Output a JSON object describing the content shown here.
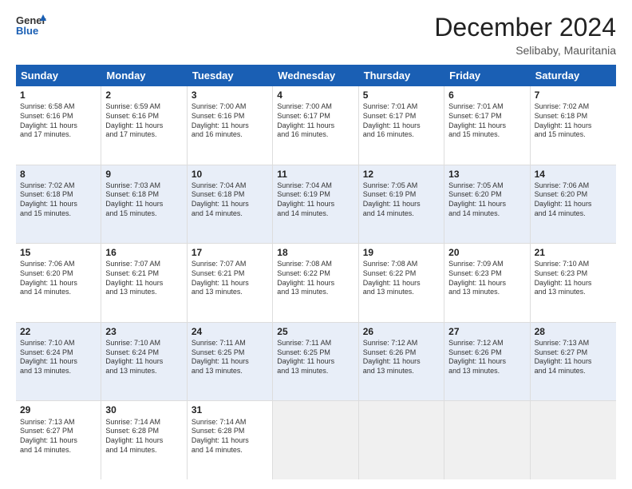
{
  "header": {
    "logo_line1": "General",
    "logo_line2": "Blue",
    "month_title": "December 2024",
    "location": "Selibaby, Mauritania"
  },
  "days_of_week": [
    "Sunday",
    "Monday",
    "Tuesday",
    "Wednesday",
    "Thursday",
    "Friday",
    "Saturday"
  ],
  "rows": [
    [
      {
        "day": "1",
        "lines": [
          "Sunrise: 6:58 AM",
          "Sunset: 6:16 PM",
          "Daylight: 11 hours",
          "and 17 minutes."
        ]
      },
      {
        "day": "2",
        "lines": [
          "Sunrise: 6:59 AM",
          "Sunset: 6:16 PM",
          "Daylight: 11 hours",
          "and 17 minutes."
        ]
      },
      {
        "day": "3",
        "lines": [
          "Sunrise: 7:00 AM",
          "Sunset: 6:16 PM",
          "Daylight: 11 hours",
          "and 16 minutes."
        ]
      },
      {
        "day": "4",
        "lines": [
          "Sunrise: 7:00 AM",
          "Sunset: 6:17 PM",
          "Daylight: 11 hours",
          "and 16 minutes."
        ]
      },
      {
        "day": "5",
        "lines": [
          "Sunrise: 7:01 AM",
          "Sunset: 6:17 PM",
          "Daylight: 11 hours",
          "and 16 minutes."
        ]
      },
      {
        "day": "6",
        "lines": [
          "Sunrise: 7:01 AM",
          "Sunset: 6:17 PM",
          "Daylight: 11 hours",
          "and 15 minutes."
        ]
      },
      {
        "day": "7",
        "lines": [
          "Sunrise: 7:02 AM",
          "Sunset: 6:18 PM",
          "Daylight: 11 hours",
          "and 15 minutes."
        ]
      }
    ],
    [
      {
        "day": "8",
        "lines": [
          "Sunrise: 7:02 AM",
          "Sunset: 6:18 PM",
          "Daylight: 11 hours",
          "and 15 minutes."
        ]
      },
      {
        "day": "9",
        "lines": [
          "Sunrise: 7:03 AM",
          "Sunset: 6:18 PM",
          "Daylight: 11 hours",
          "and 15 minutes."
        ]
      },
      {
        "day": "10",
        "lines": [
          "Sunrise: 7:04 AM",
          "Sunset: 6:18 PM",
          "Daylight: 11 hours",
          "and 14 minutes."
        ]
      },
      {
        "day": "11",
        "lines": [
          "Sunrise: 7:04 AM",
          "Sunset: 6:19 PM",
          "Daylight: 11 hours",
          "and 14 minutes."
        ]
      },
      {
        "day": "12",
        "lines": [
          "Sunrise: 7:05 AM",
          "Sunset: 6:19 PM",
          "Daylight: 11 hours",
          "and 14 minutes."
        ]
      },
      {
        "day": "13",
        "lines": [
          "Sunrise: 7:05 AM",
          "Sunset: 6:20 PM",
          "Daylight: 11 hours",
          "and 14 minutes."
        ]
      },
      {
        "day": "14",
        "lines": [
          "Sunrise: 7:06 AM",
          "Sunset: 6:20 PM",
          "Daylight: 11 hours",
          "and 14 minutes."
        ]
      }
    ],
    [
      {
        "day": "15",
        "lines": [
          "Sunrise: 7:06 AM",
          "Sunset: 6:20 PM",
          "Daylight: 11 hours",
          "and 14 minutes."
        ]
      },
      {
        "day": "16",
        "lines": [
          "Sunrise: 7:07 AM",
          "Sunset: 6:21 PM",
          "Daylight: 11 hours",
          "and 13 minutes."
        ]
      },
      {
        "day": "17",
        "lines": [
          "Sunrise: 7:07 AM",
          "Sunset: 6:21 PM",
          "Daylight: 11 hours",
          "and 13 minutes."
        ]
      },
      {
        "day": "18",
        "lines": [
          "Sunrise: 7:08 AM",
          "Sunset: 6:22 PM",
          "Daylight: 11 hours",
          "and 13 minutes."
        ]
      },
      {
        "day": "19",
        "lines": [
          "Sunrise: 7:08 AM",
          "Sunset: 6:22 PM",
          "Daylight: 11 hours",
          "and 13 minutes."
        ]
      },
      {
        "day": "20",
        "lines": [
          "Sunrise: 7:09 AM",
          "Sunset: 6:23 PM",
          "Daylight: 11 hours",
          "and 13 minutes."
        ]
      },
      {
        "day": "21",
        "lines": [
          "Sunrise: 7:10 AM",
          "Sunset: 6:23 PM",
          "Daylight: 11 hours",
          "and 13 minutes."
        ]
      }
    ],
    [
      {
        "day": "22",
        "lines": [
          "Sunrise: 7:10 AM",
          "Sunset: 6:24 PM",
          "Daylight: 11 hours",
          "and 13 minutes."
        ]
      },
      {
        "day": "23",
        "lines": [
          "Sunrise: 7:10 AM",
          "Sunset: 6:24 PM",
          "Daylight: 11 hours",
          "and 13 minutes."
        ]
      },
      {
        "day": "24",
        "lines": [
          "Sunrise: 7:11 AM",
          "Sunset: 6:25 PM",
          "Daylight: 11 hours",
          "and 13 minutes."
        ]
      },
      {
        "day": "25",
        "lines": [
          "Sunrise: 7:11 AM",
          "Sunset: 6:25 PM",
          "Daylight: 11 hours",
          "and 13 minutes."
        ]
      },
      {
        "day": "26",
        "lines": [
          "Sunrise: 7:12 AM",
          "Sunset: 6:26 PM",
          "Daylight: 11 hours",
          "and 13 minutes."
        ]
      },
      {
        "day": "27",
        "lines": [
          "Sunrise: 7:12 AM",
          "Sunset: 6:26 PM",
          "Daylight: 11 hours",
          "and 13 minutes."
        ]
      },
      {
        "day": "28",
        "lines": [
          "Sunrise: 7:13 AM",
          "Sunset: 6:27 PM",
          "Daylight: 11 hours",
          "and 14 minutes."
        ]
      }
    ],
    [
      {
        "day": "29",
        "lines": [
          "Sunrise: 7:13 AM",
          "Sunset: 6:27 PM",
          "Daylight: 11 hours",
          "and 14 minutes."
        ]
      },
      {
        "day": "30",
        "lines": [
          "Sunrise: 7:14 AM",
          "Sunset: 6:28 PM",
          "Daylight: 11 hours",
          "and 14 minutes."
        ]
      },
      {
        "day": "31",
        "lines": [
          "Sunrise: 7:14 AM",
          "Sunset: 6:28 PM",
          "Daylight: 11 hours",
          "and 14 minutes."
        ]
      },
      {
        "day": "",
        "lines": []
      },
      {
        "day": "",
        "lines": []
      },
      {
        "day": "",
        "lines": []
      },
      {
        "day": "",
        "lines": []
      }
    ]
  ]
}
